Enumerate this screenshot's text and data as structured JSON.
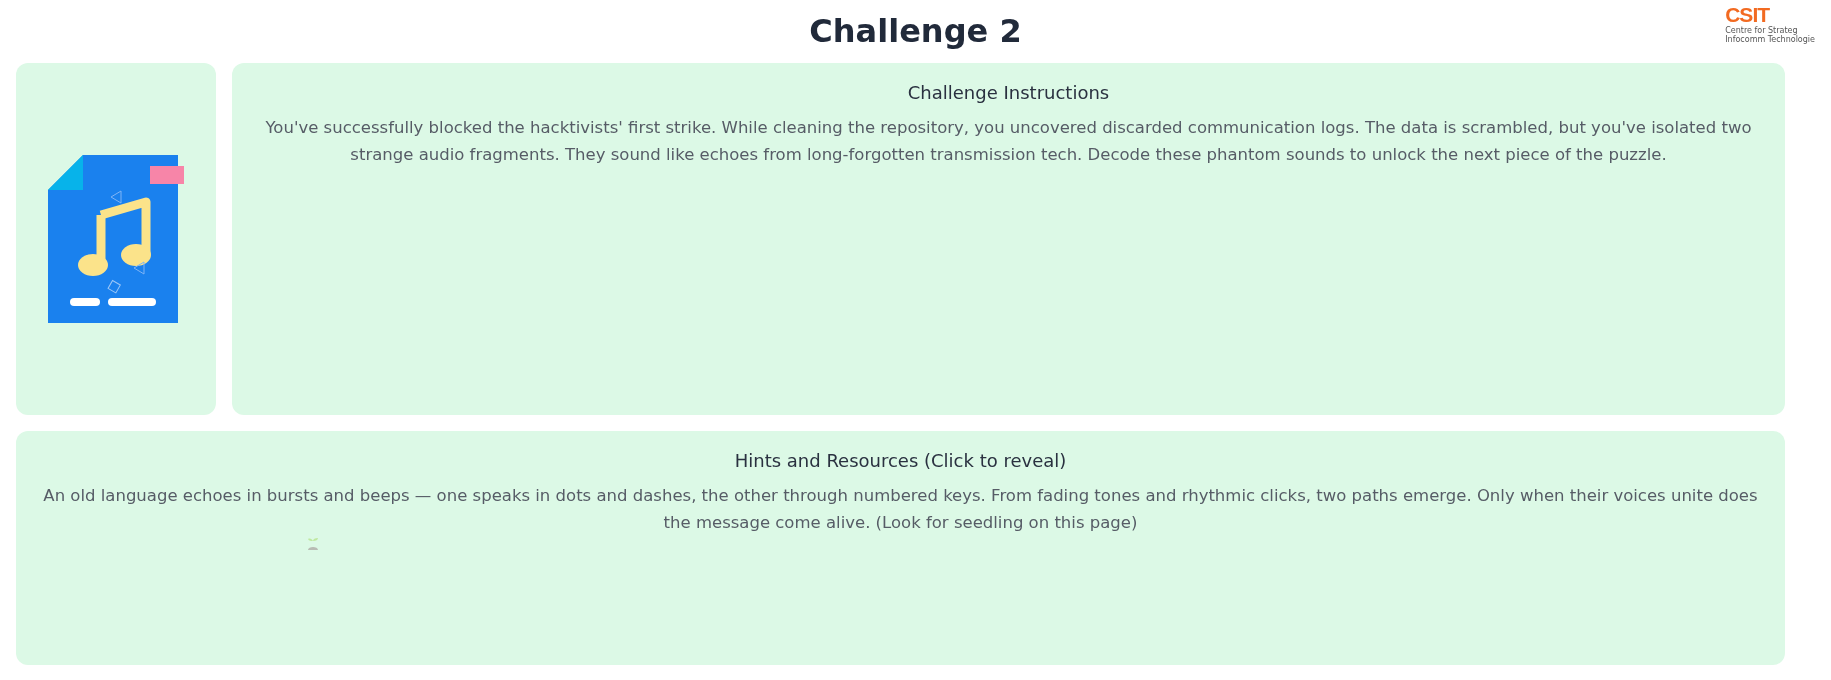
{
  "title": "Challenge 2",
  "logo": {
    "mark": "CSIT",
    "lines": [
      "Centre for Strateg",
      "Infocomm Technologie"
    ]
  },
  "instructions": {
    "heading": "Challenge Instructions",
    "text": "You've successfully blocked the hacktivists' first strike. While cleaning the repository, you uncovered discarded communication logs. The data is scrambled, but you've isolated two strange audio fragments. They sound like echoes from long-forgotten transmission tech. Decode these phantom sounds to unlock the next piece of the puzzle."
  },
  "hints": {
    "heading": "Hints and Resources (Click to reveal)",
    "text": "An old language echoes in bursts and beeps — one speaks in dots and dashes, the other through numbered keys. From fading tones and rhythmic clicks, two paths emerge. Only when their voices unite does the message come alive. (Look for seedling on this page)"
  }
}
